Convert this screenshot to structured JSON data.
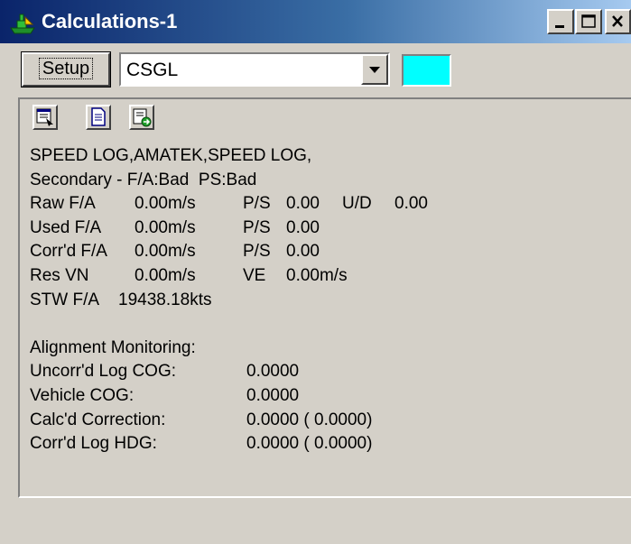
{
  "window": {
    "title": "Calculations-1",
    "controls": {
      "minimize": "minimize-button",
      "maximize": "maximize-button",
      "close": "close-button"
    }
  },
  "toolbar": {
    "setup_label": "Setup",
    "combo_value": "CSGL",
    "swatch_color": "#00ffff"
  },
  "panel_toolbar": {
    "buttons": [
      "view-icon",
      "document-icon",
      "export-icon"
    ]
  },
  "readout": {
    "line1": "SPEED LOG,AMATEK,SPEED LOG,",
    "line2": "Secondary - F/A:Bad  PS:Bad",
    "raw": {
      "label": "Raw F/A",
      "fa": "0.00m/s",
      "ps_label": "P/S",
      "ps": "0.00",
      "ud_label": "U/D",
      "ud": "0.00"
    },
    "used": {
      "label": "Used F/A",
      "fa": "0.00m/s",
      "ps_label": "P/S",
      "ps": "0.00"
    },
    "corr": {
      "label": "Corr'd F/A",
      "fa": "0.00m/s",
      "ps_label": "P/S",
      "ps": "0.00"
    },
    "res": {
      "label": "Res VN",
      "vn": "0.00m/s",
      "ve_label": "VE",
      "ve": "0.00m/s"
    },
    "stw": {
      "label": "STW F/A",
      "value": "19438.18kts"
    }
  },
  "alignment": {
    "heading": "Alignment Monitoring:",
    "rows": [
      {
        "label": "Uncorr'd Log COG:",
        "value": "0.0000"
      },
      {
        "label": "Vehicle COG:",
        "value": "0.0000"
      },
      {
        "label": "Calc'd Correction:",
        "value": "0.0000 ( 0.0000)"
      },
      {
        "label": "Corr'd Log HDG:",
        "value": "0.0000 ( 0.0000)"
      }
    ]
  }
}
